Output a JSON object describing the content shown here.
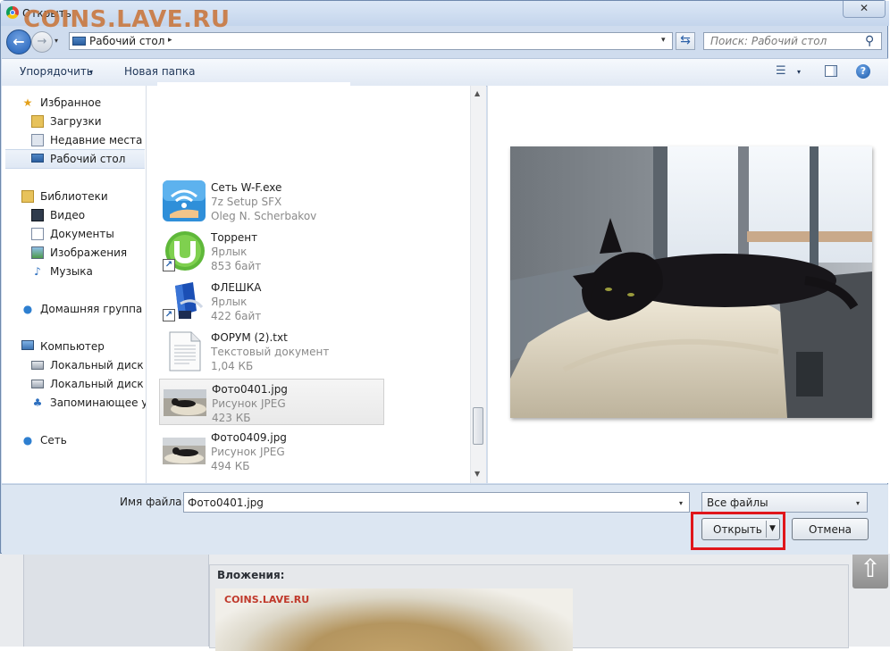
{
  "watermark": "COINS.LAVE.RU",
  "window": {
    "title": "Открыть",
    "close_glyph": "✕"
  },
  "nav_buttons": {
    "back": "←",
    "forward": "→",
    "history": "▾"
  },
  "address": {
    "path": "Рабочий стол",
    "separator": "▸",
    "dropdown": "▾",
    "refresh_glyph": "⇆"
  },
  "search": {
    "placeholder": "Поиск: Рабочий стол",
    "icon": "search-icon"
  },
  "toolbar": {
    "organize": "Упорядочить",
    "organize_arrow": "▾",
    "new_folder": "Новая папка",
    "view_glyph": "☰",
    "view_arrow": "▾",
    "help": "?"
  },
  "sidebar": {
    "favorites": {
      "label": "Избранное",
      "items": [
        "Загрузки",
        "Недавние места",
        "Рабочий стол"
      ],
      "selected": "Рабочий стол"
    },
    "libraries": {
      "label": "Библиотеки",
      "items": [
        "Видео",
        "Документы",
        "Изображения",
        "Музыка"
      ]
    },
    "homegroup": "Домашняя группа",
    "computer": {
      "label": "Компьютер",
      "items": [
        "Локальный диск (C",
        "Локальный диск (E:",
        "Запоминающее ус"
      ]
    },
    "network": "Сеть"
  },
  "files": [
    {
      "name": "Сеть W-F.exe",
      "type": "7z Setup SFX",
      "meta": "Oleg N. Scherbakov",
      "icon": "wifi-icon"
    },
    {
      "name": "Торрент",
      "type": "Ярлык",
      "meta": "853 байт",
      "icon": "utorrent-icon"
    },
    {
      "name": "ФЛЕШКА",
      "type": "Ярлык",
      "meta": "422 байт",
      "icon": "usb-flash-icon"
    },
    {
      "name": "ФОРУМ (2).txt",
      "type": "Текстовый документ",
      "meta": "1,04 КБ",
      "icon": "text-file-icon"
    },
    {
      "name": "Фото0401.jpg",
      "type": "Рисунок JPEG",
      "meta": "423 КБ",
      "icon": "photo-thumbnail",
      "selected": true
    },
    {
      "name": "Фото0409.jpg",
      "type": "Рисунок JPEG",
      "meta": "494 КБ",
      "icon": "photo-thumbnail"
    }
  ],
  "scrollbar": {
    "up": "▲",
    "down": "▼"
  },
  "preview": {
    "subject": "photo-preview"
  },
  "bottom": {
    "filename_label": "Имя файла:",
    "filename_value": "Фото0401.jpg",
    "dropdown": "▾",
    "filter": "Все файлы",
    "open": "Открыть",
    "open_arrow": "▼",
    "cancel": "Отмена"
  },
  "background_page": {
    "attachments_title": "Вложения:",
    "image_watermark": "COINS.LAVE.RU",
    "scroll_up_glyph": "⇧"
  },
  "colors": {
    "highlight_red": "#e0161c",
    "titlebar": "#c4d5ec",
    "watermark": "#c97a43"
  }
}
